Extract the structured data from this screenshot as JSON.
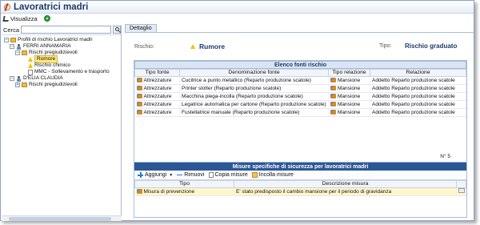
{
  "app": {
    "title": "Lavoratrici madri",
    "toolbar": {
      "view_label": "Visualizza"
    }
  },
  "search": {
    "label": "Cerca",
    "value": "",
    "placeholder": ""
  },
  "tree": {
    "root": "Profili di rischio Lavoratrici madri",
    "person1": "FERRI ANNAMARIA",
    "folder1": "Rischi pregiudizievoli",
    "risk1": "Rumore",
    "risk2": "Rischio chimico",
    "risk3": "MMC - Sollevamento e trasporto",
    "person2": "D'ELIA CLAUDIA",
    "folder2": "Rischi pregiudizievoli"
  },
  "detail": {
    "tab": "Dettaglio",
    "rischio_label": "Rischio:",
    "rischio_value": "Rumore",
    "tipo_label": "Tipo:",
    "tipo_value": "Rischio graduato"
  },
  "fonti": {
    "title": "Elenco fonti rischio",
    "headers": [
      "Tipo fonte",
      "Denominazione fonte",
      "Tipo relazione",
      "Relazione"
    ],
    "rows": [
      [
        "Attrezzature",
        "Cucitrice a punto metallico (Reparto produzione scatole)",
        "Mansione",
        "Addetto Reparto produzione scatole"
      ],
      [
        "Attrezzature",
        "Printer slotter (Reparto produzione scatole)",
        "Mansione",
        "Addetto Reparto produzione scatole"
      ],
      [
        "Attrezzature",
        "Macchina piega-incolla (Reparto produzione scatole)",
        "Mansione",
        "Addetto Reparto produzione scatole"
      ],
      [
        "Attrezzature",
        "Legatrice automatica per cartone (Reparto produzione scatole)",
        "Mansione",
        "Addetto Reparto produzione scatole"
      ],
      [
        "Attrezzature",
        "Fustellatrice manuale (Reparto produzione scatole)",
        "Mansione",
        "Addetto Reparto produzione scatole"
      ]
    ],
    "count": "N° 5"
  },
  "misure": {
    "title": "Misure specifiche di sicurezza per lavoratrici madri",
    "toolbar": {
      "add": "Aggiungi",
      "remove": "Rimuovi",
      "copy": "Copia misure",
      "merge": "Incolla misure"
    },
    "headers": [
      "Tipo",
      "Descrizione misura"
    ],
    "rows": [
      [
        "Misura di prevenzione",
        "E' stato predisposto il cambio mansione per il periodo di gravidanza"
      ]
    ]
  }
}
